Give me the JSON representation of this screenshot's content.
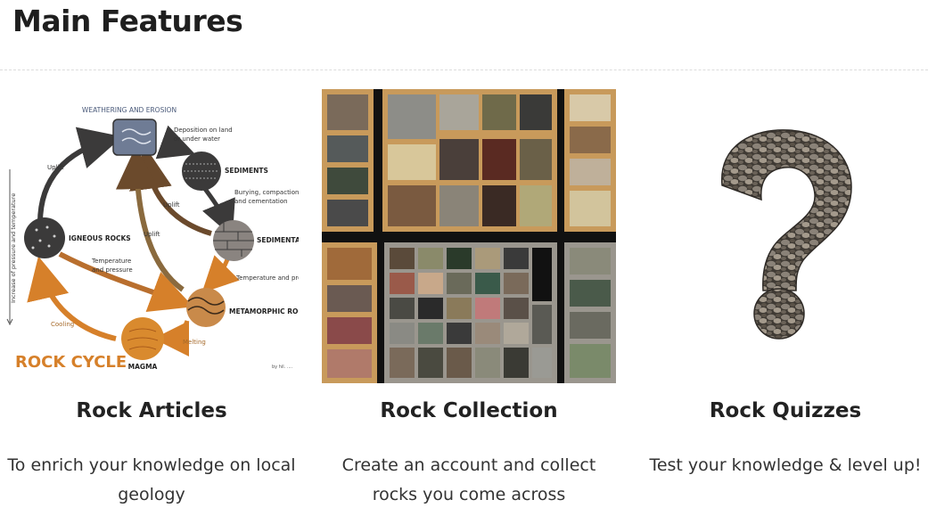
{
  "page": {
    "title": "Main Features"
  },
  "features": [
    {
      "title": "Rock Articles",
      "description": "To enrich your knowledge on local geology",
      "image": "rock-cycle-diagram",
      "diagram": {
        "heading": "ROCK CYCLE",
        "credit": "by hil. ....",
        "nodes": {
          "weathering": "WEATHERING AND EROSION",
          "sediments": "SEDIMENTS",
          "sedimentary": "SEDIMENTARY",
          "igneous": "IGNEOUS ROCKS",
          "metamorphic": "METAMORPHIC ROCKS",
          "magma": "MAGMA"
        },
        "labels": {
          "deposition": "Deposition on land",
          "deposition2": "or under water",
          "burying": "Burying, compaction",
          "burying2": "and cementation",
          "uplift1": "Uplift",
          "uplift2": "Uplift",
          "uplift3": "Uplift",
          "temp1": "Temperature",
          "temp2": "and pressure",
          "temp3": "Temperature and pre",
          "cooling": "Cooling",
          "melting": "Melting",
          "axis": "Increase of pressure and temperature"
        }
      }
    },
    {
      "title": "Rock Collection",
      "description": "Create an account and collect rocks you come across",
      "image": "rock-collection-photo"
    },
    {
      "title": "Rock Quizzes",
      "description": "Test your knowledge & level up!",
      "image": "stone-question-mark"
    }
  ],
  "colors": {
    "heading": "#1f1f1f",
    "orange": "#d6802a",
    "brown": "#5b3a22",
    "dark": "#3b3a3a",
    "wood": "#c89a5b"
  }
}
